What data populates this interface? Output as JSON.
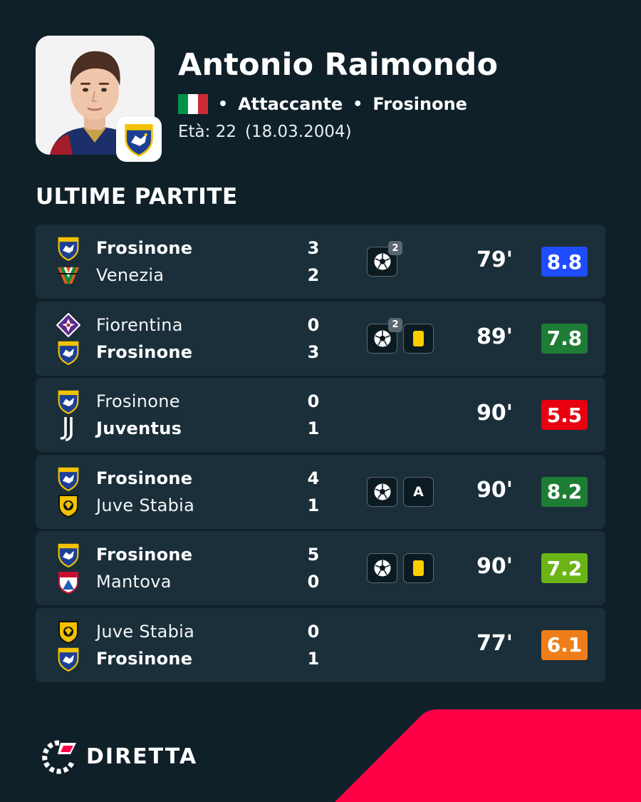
{
  "player": {
    "name": "Antonio Raimondo",
    "position": "Attaccante",
    "team": "Frosinone",
    "age_label": "Età: 22",
    "birthdate": "(18.03.2004)",
    "flag_colors": [
      "#009246",
      "#ffffff",
      "#ce2b37"
    ]
  },
  "section_title": "ULTIME PARTITE",
  "colors": {
    "background": "#0f2029",
    "row": "#1b2f3a",
    "accent_red": "#ff0046",
    "rating_blue": "#1f4cff",
    "rating_green": "#1e7d35",
    "rating_red": "#e8000f",
    "rating_lime": "#6ab515",
    "rating_orange": "#ef7e1a",
    "yellow_card": "#ffcd00"
  },
  "matches": [
    {
      "home": {
        "name": "Frosinone",
        "score": "3",
        "logo": "frosinone-logo"
      },
      "away": {
        "name": "Venezia",
        "score": "2",
        "logo": "venezia-logo"
      },
      "events": [
        {
          "icon": "goal-icon",
          "count": "2"
        }
      ],
      "minutes": "79'",
      "rating": "8.8"
    },
    {
      "home": {
        "name": "Fiorentina",
        "score": "0",
        "logo": "fiorentina-logo"
      },
      "away": {
        "name": "Frosinone",
        "score": "3",
        "logo": "frosinone-logo"
      },
      "events": [
        {
          "icon": "goal-icon",
          "count": "2"
        },
        {
          "icon": "yellow-card-icon"
        }
      ],
      "minutes": "89'",
      "rating": "7.8"
    },
    {
      "home": {
        "name": "Frosinone",
        "score": "0",
        "logo": "frosinone-logo"
      },
      "away": {
        "name": "Juventus",
        "score": "1",
        "logo": "juventus-logo"
      },
      "events": [],
      "minutes": "90'",
      "rating": "5.5"
    },
    {
      "home": {
        "name": "Frosinone",
        "score": "4",
        "logo": "frosinone-logo"
      },
      "away": {
        "name": "Juve Stabia",
        "score": "1",
        "logo": "juve-stabia-logo"
      },
      "events": [
        {
          "icon": "goal-icon"
        },
        {
          "icon": "assist-icon",
          "label": "A"
        }
      ],
      "minutes": "90'",
      "rating": "8.2"
    },
    {
      "home": {
        "name": "Frosinone",
        "score": "5",
        "logo": "frosinone-logo"
      },
      "away": {
        "name": "Mantova",
        "score": "0",
        "logo": "mantova-logo"
      },
      "events": [
        {
          "icon": "goal-icon"
        },
        {
          "icon": "yellow-card-icon"
        }
      ],
      "minutes": "90'",
      "rating": "7.2"
    },
    {
      "home": {
        "name": "Juve Stabia",
        "score": "0",
        "logo": "juve-stabia-logo"
      },
      "away": {
        "name": "Frosinone",
        "score": "1",
        "logo": "frosinone-logo"
      },
      "events": [],
      "minutes": "77'",
      "rating": "6.1"
    }
  ],
  "brand": {
    "name": "DIRETTA"
  }
}
